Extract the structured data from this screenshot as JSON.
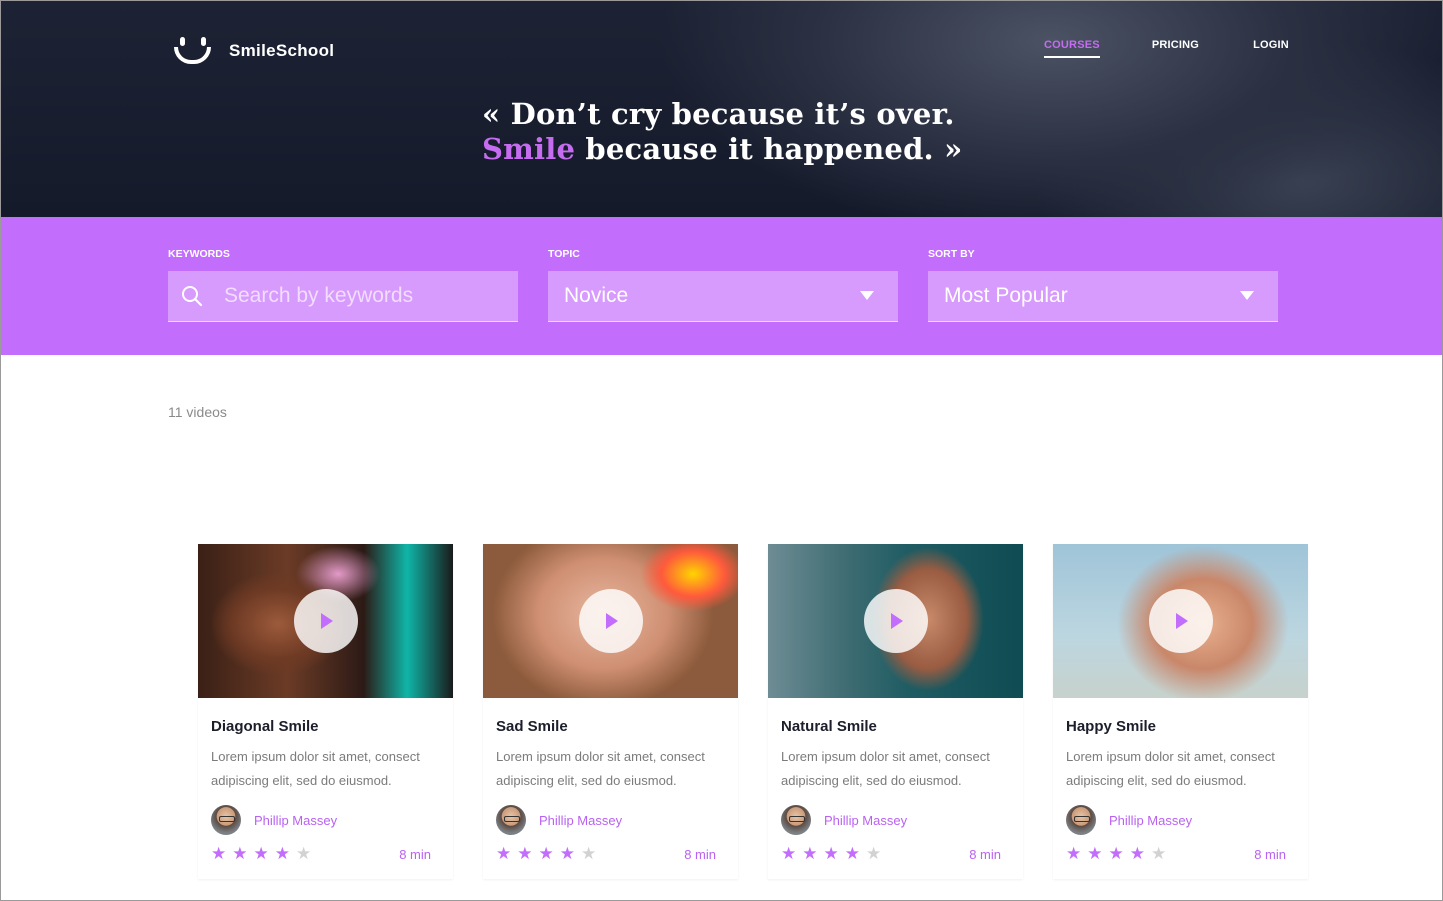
{
  "brand": {
    "name": "SmileSchool"
  },
  "nav": {
    "items": [
      {
        "label": "COURSES",
        "active": true
      },
      {
        "label": "PRICING",
        "active": false
      },
      {
        "label": "LOGIN",
        "active": false
      }
    ]
  },
  "hero": {
    "quote_line1": "« Don’t cry because it’s over.",
    "quote_highlight": "Smile",
    "quote_line2_rest": " because it happened. »"
  },
  "filters": {
    "keywords": {
      "label": "KEYWORDS",
      "placeholder": "Search by keywords",
      "icon": "search-icon"
    },
    "topic": {
      "label": "TOPIC",
      "value": "Novice"
    },
    "sort": {
      "label": "SORT BY",
      "value": "Most Popular"
    }
  },
  "results": {
    "count_text": "11 videos"
  },
  "colors": {
    "accent": "#c26dfc",
    "hero_bg": "#1d2334",
    "star_off": "#d2d2d2"
  },
  "videos": [
    {
      "title": "Diagonal Smile",
      "description": "Lorem ipsum dolor sit amet, consect adipiscing elit, sed do eiusmod.",
      "author": "Phillip Massey",
      "rating": 4,
      "duration": "8 min"
    },
    {
      "title": "Sad Smile",
      "description": "Lorem ipsum dolor sit amet, consect adipiscing elit, sed do eiusmod.",
      "author": "Phillip Massey",
      "rating": 4,
      "duration": "8 min"
    },
    {
      "title": "Natural Smile",
      "description": "Lorem ipsum dolor sit amet, consect adipiscing elit, sed do eiusmod.",
      "author": "Phillip Massey",
      "rating": 4,
      "duration": "8 min"
    },
    {
      "title": "Happy Smile",
      "description": "Lorem ipsum dolor sit amet, consect adipiscing elit, sed do eiusmod.",
      "author": "Phillip Massey",
      "rating": 4,
      "duration": "8 min"
    }
  ]
}
